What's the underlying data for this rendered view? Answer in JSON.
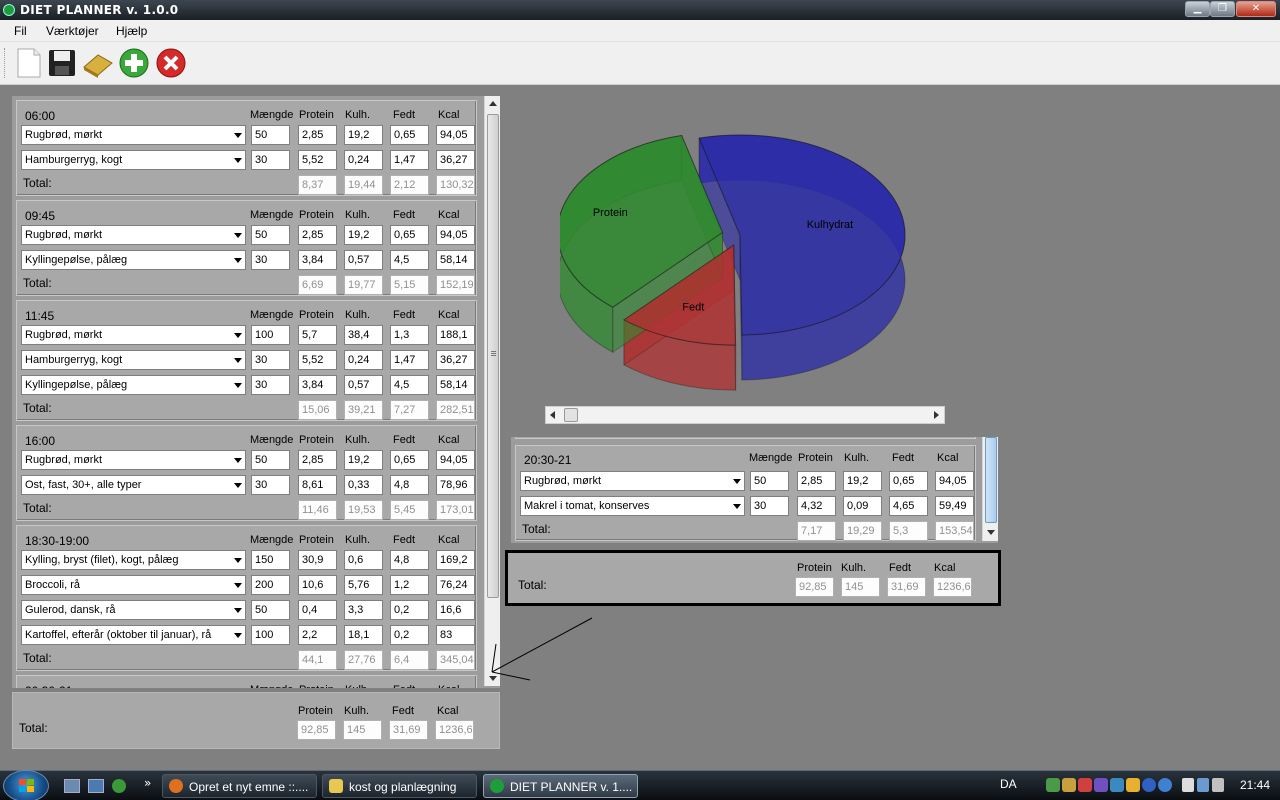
{
  "window": {
    "title": "DIET PLANNER v. 1.0.0"
  },
  "menu": [
    "Fil",
    "Værktøjer",
    "Hjælp"
  ],
  "toolbar": [
    "new-file-icon",
    "save-icon",
    "eraser-icon",
    "add-icon",
    "delete-icon"
  ],
  "headers": {
    "amount": "Mængde",
    "protein": "Protein",
    "carbs": "Kulh.",
    "fat": "Fedt",
    "kcal": "Kcal"
  },
  "total_label": "Total:",
  "meals": [
    {
      "time": "06:00",
      "items": [
        {
          "food": "Rugbrød, mørkt",
          "amount": "50",
          "protein": "2,85",
          "carbs": "19,2",
          "fat": "0,65",
          "kcal": "94,05"
        },
        {
          "food": "Hamburgerryg, kogt",
          "amount": "30",
          "protein": "5,52",
          "carbs": "0,24",
          "fat": "1,47",
          "kcal": "36,27"
        }
      ],
      "total": {
        "protein": "8,37",
        "carbs": "19,44",
        "fat": "2,12",
        "kcal": "130,32"
      }
    },
    {
      "time": "09:45",
      "items": [
        {
          "food": "Rugbrød, mørkt",
          "amount": "50",
          "protein": "2,85",
          "carbs": "19,2",
          "fat": "0,65",
          "kcal": "94,05"
        },
        {
          "food": "Kyllingepølse, pålæg",
          "amount": "30",
          "protein": "3,84",
          "carbs": "0,57",
          "fat": "4,5",
          "kcal": "58,14"
        }
      ],
      "total": {
        "protein": "6,69",
        "carbs": "19,77",
        "fat": "5,15",
        "kcal": "152,19"
      }
    },
    {
      "time": "11:45",
      "items": [
        {
          "food": "Rugbrød, mørkt",
          "amount": "100",
          "protein": "5,7",
          "carbs": "38,4",
          "fat": "1,3",
          "kcal": "188,1"
        },
        {
          "food": "Hamburgerryg, kogt",
          "amount": "30",
          "protein": "5,52",
          "carbs": "0,24",
          "fat": "1,47",
          "kcal": "36,27"
        },
        {
          "food": "Kyllingepølse, pålæg",
          "amount": "30",
          "protein": "3,84",
          "carbs": "0,57",
          "fat": "4,5",
          "kcal": "58,14"
        }
      ],
      "total": {
        "protein": "15,06",
        "carbs": "39,21",
        "fat": "7,27",
        "kcal": "282,51"
      }
    },
    {
      "time": "16:00",
      "items": [
        {
          "food": "Rugbrød, mørkt",
          "amount": "50",
          "protein": "2,85",
          "carbs": "19,2",
          "fat": "0,65",
          "kcal": "94,05"
        },
        {
          "food": "Ost, fast, 30+, alle typer",
          "amount": "30",
          "protein": "8,61",
          "carbs": "0,33",
          "fat": "4,8",
          "kcal": "78,96"
        }
      ],
      "total": {
        "protein": "11,46",
        "carbs": "19,53",
        "fat": "5,45",
        "kcal": "173,01"
      }
    },
    {
      "time": "18:30-19:00",
      "items": [
        {
          "food": "Kylling, bryst (filet), kogt, pålæg",
          "amount": "150",
          "protein": "30,9",
          "carbs": "0,6",
          "fat": "4,8",
          "kcal": "169,2"
        },
        {
          "food": "Broccoli, rå",
          "amount": "200",
          "protein": "10,6",
          "carbs": "5,76",
          "fat": "1,2",
          "kcal": "76,24"
        },
        {
          "food": "Gulerod, dansk, rå",
          "amount": "50",
          "protein": "0,4",
          "carbs": "3,3",
          "fat": "0,2",
          "kcal": "16,6"
        },
        {
          "food": "Kartoffel, efterår (oktober til januar), rå",
          "amount": "100",
          "protein": "2,2",
          "carbs": "18,1",
          "fat": "0,2",
          "kcal": "83"
        }
      ],
      "total": {
        "protein": "44,1",
        "carbs": "27,76",
        "fat": "6,4",
        "kcal": "345,04"
      }
    },
    {
      "time": "20:30-21",
      "items": [
        {
          "food": "Rugbrød, mørkt",
          "amount": "50",
          "protein": "2,85",
          "carbs": "19,2",
          "fat": "0,65",
          "kcal": "94,05"
        },
        {
          "food": "Makrel i tomat, konserves",
          "amount": "30",
          "protein": "4,32",
          "carbs": "0,09",
          "fat": "4,65",
          "kcal": "59,49"
        }
      ],
      "total": {
        "protein": "7,17",
        "carbs": "19,29",
        "fat": "5,3",
        "kcal": "153,54"
      }
    }
  ],
  "grand_total": {
    "protein": "92,85",
    "carbs": "145",
    "fat": "31,69",
    "kcal": "1236,6"
  },
  "chart_data": {
    "type": "pie",
    "title": "",
    "categories": [
      "Kulhydrat",
      "Fedt",
      "Protein"
    ],
    "values": [
      145,
      31.69,
      92.85
    ],
    "colors": [
      "#2a2aa8",
      "#b03030",
      "#2e8a2e"
    ]
  },
  "taskbar": {
    "tasks": [
      {
        "label": "Opret et nyt emne ::...."
      },
      {
        "label": "kost og planlægning"
      },
      {
        "label": "DIET PLANNER v. 1...."
      }
    ],
    "lang": "DA",
    "clock": "21:44"
  }
}
